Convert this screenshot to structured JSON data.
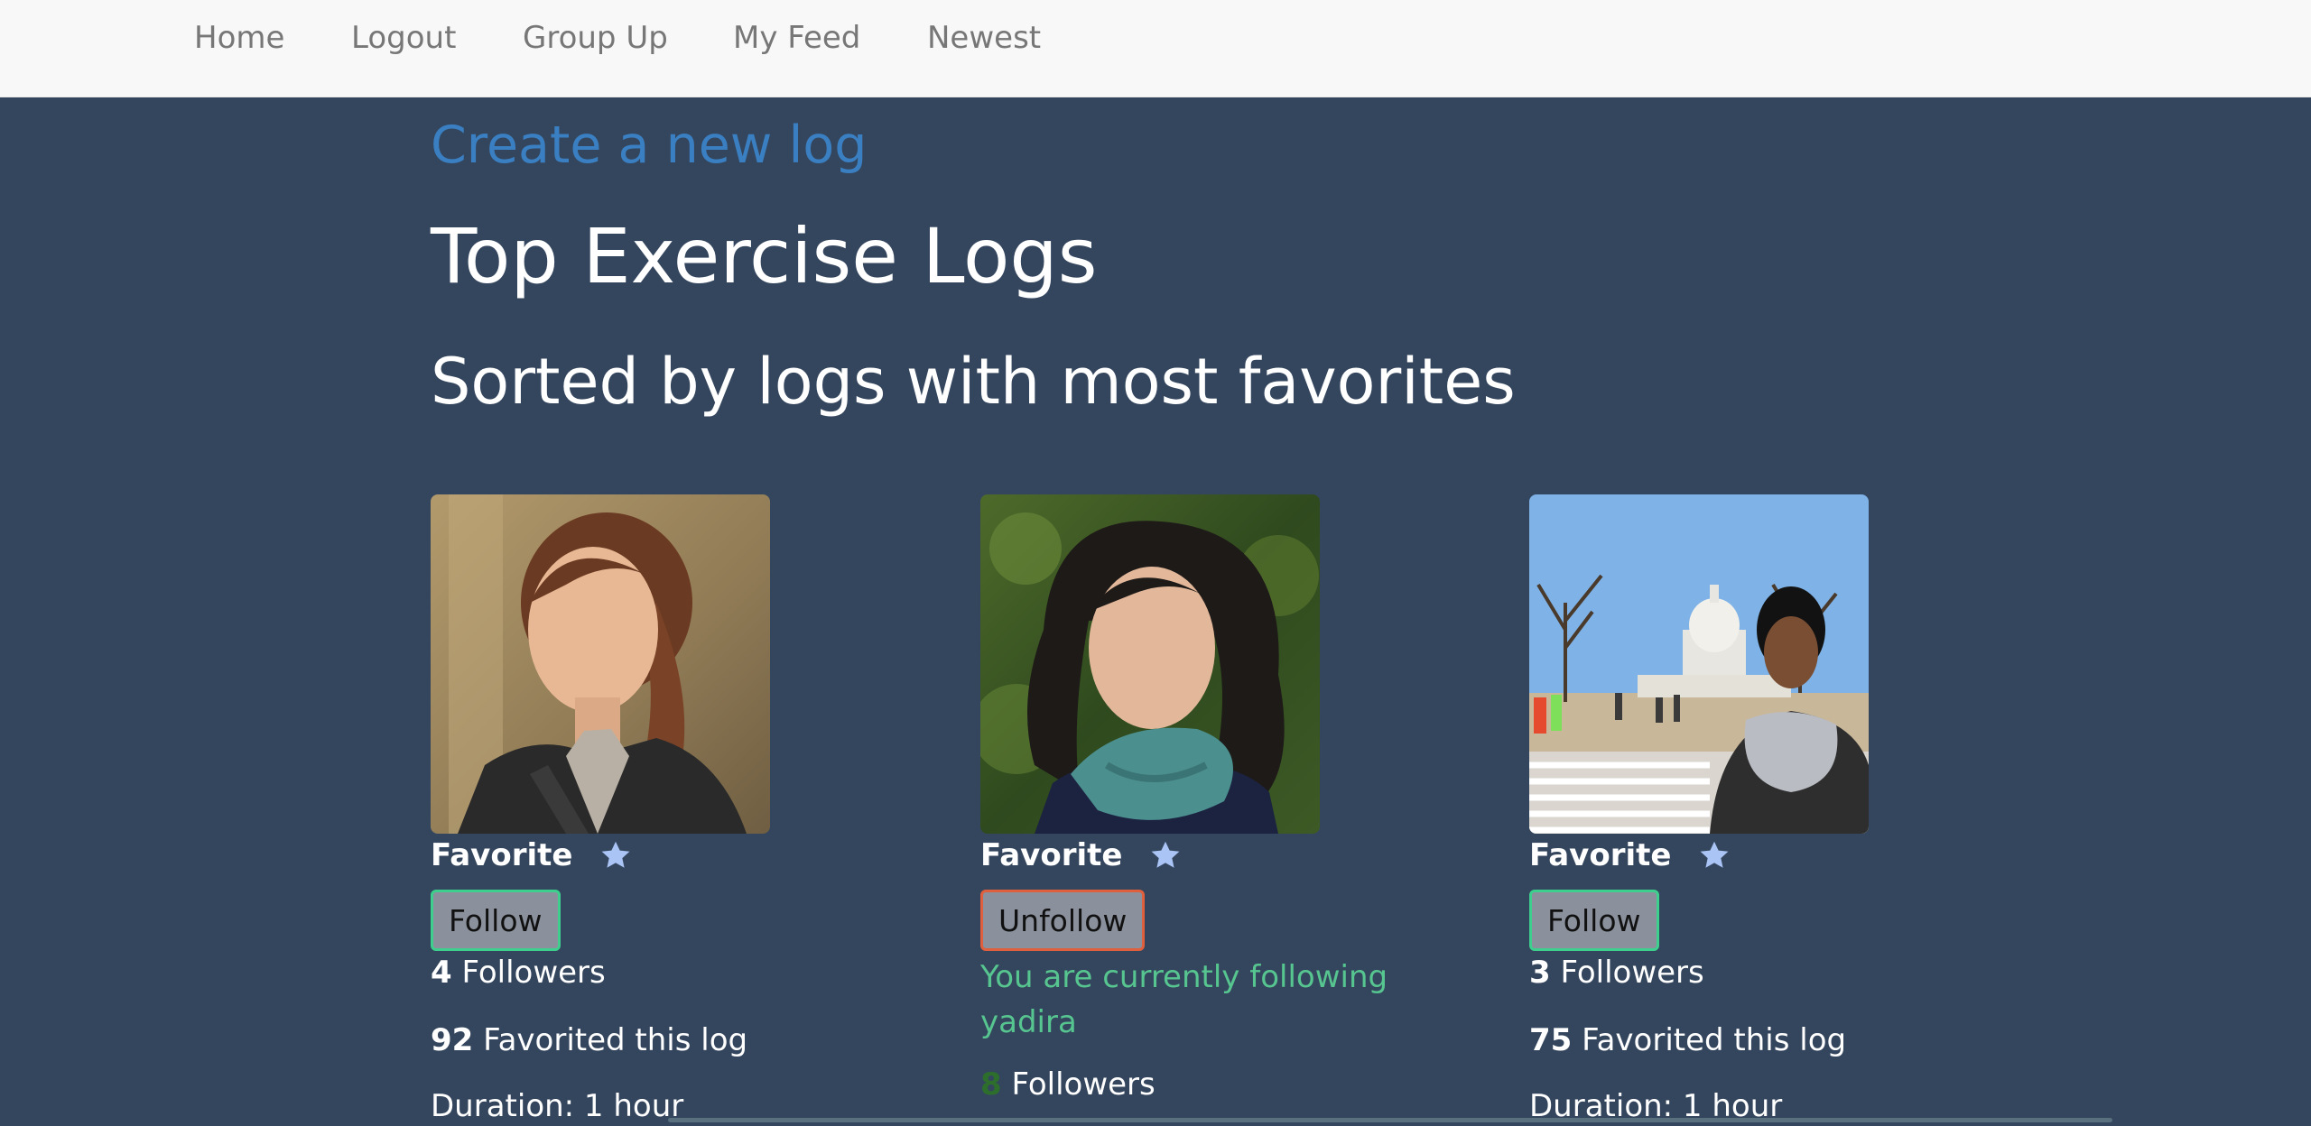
{
  "nav": {
    "items": [
      {
        "label": "Home"
      },
      {
        "label": "Logout"
      },
      {
        "label": "Group Up"
      },
      {
        "label": "My Feed"
      },
      {
        "label": "Newest"
      }
    ]
  },
  "main": {
    "create_link": "Create a new log",
    "title": "Top Exercise Logs",
    "subtitle": "Sorted by logs with most favorites"
  },
  "cards": [
    {
      "favorite_label": "Favorite",
      "button_label": "Follow",
      "followers_count": "4",
      "followers_label": "Followers",
      "favorited_count": "92",
      "favorited_label": "Favorited this log",
      "duration": "Duration: 1 hour"
    },
    {
      "favorite_label": "Favorite",
      "button_label": "Unfollow",
      "following_message": "You are currently following yadira",
      "followers_count": "8",
      "followers_label": "Followers"
    },
    {
      "favorite_label": "Favorite",
      "button_label": "Follow",
      "followers_count": "3",
      "followers_label": "Followers",
      "favorited_count": "75",
      "favorited_label": "Favorited this log",
      "duration": "Duration: 1 hour"
    }
  ],
  "colors": {
    "background": "#34465e",
    "navbar": "#f8f8f8",
    "link": "#3a7fc1",
    "follow_border": "#3ecf8e",
    "unfollow_border": "#e0603e",
    "following_text": "#57c58f",
    "star": "#a9c4f5"
  }
}
